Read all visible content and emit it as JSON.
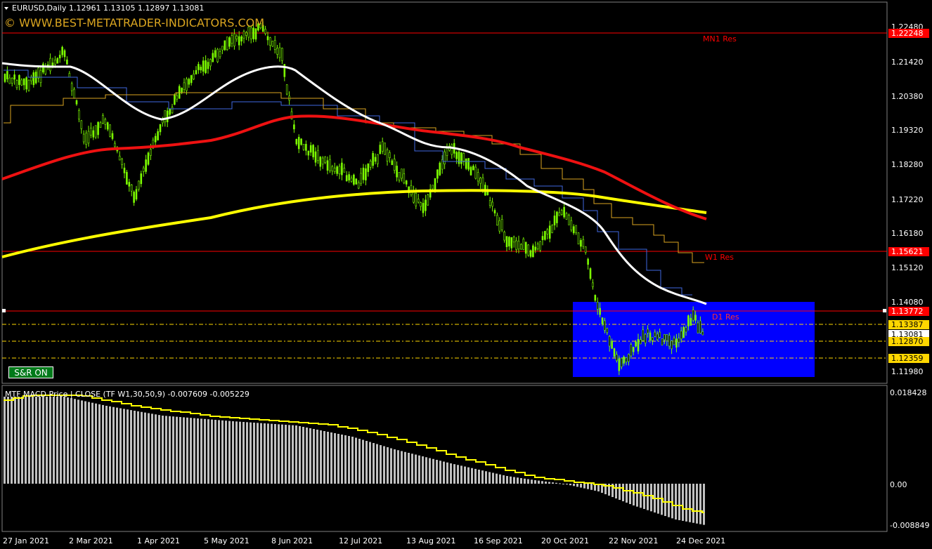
{
  "header": {
    "symbol_line": "EURUSD,Daily  1.12961 1.13105 1.12897 1.13081",
    "watermark": "© WWW.BEST-METATRADER-INDICATORS.COM"
  },
  "levels": {
    "mn1": {
      "label": "MN1 Res",
      "price": "1.22248"
    },
    "w1": {
      "label": "W1 Res",
      "price": "1.15621"
    },
    "d1": {
      "label": "D1 Res",
      "price": "1.13772"
    },
    "current": "1.13081",
    "dotted": [
      "1.13387",
      "1.12870",
      "1.12359"
    ]
  },
  "price_axis": [
    "1.22480",
    "1.21420",
    "1.20380",
    "1.19320",
    "1.18280",
    "1.17220",
    "1.16180",
    "1.15120",
    "1.14080",
    "1.11980"
  ],
  "button": {
    "label": "S&R  ON"
  },
  "macd": {
    "title": "MTF MACD Price | CLOSE  (TF W1,30,50,9) -0.007609 -0.005229",
    "axis": [
      "0.018428",
      "0.00",
      "-0.008849"
    ]
  },
  "time_axis": [
    "27 Jan 2021",
    "2 Mar 2021",
    "1 Apr 2021",
    "5 May 2021",
    "8 Jun 2021",
    "12 Jul 2021",
    "13 Aug 2021",
    "16 Sep 2021",
    "20 Oct 2021",
    "22 Nov 2021",
    "24 Dec 2021"
  ],
  "colors": {
    "background": "#000000",
    "bull_candle": "#7CFC00",
    "ma_red": "#ff0000",
    "ma_yellow": "#ffff00",
    "ma_white": "#ffffff",
    "zone": "#0000ff",
    "level_line": "#ff0000",
    "macd_hist": "#c0c0c0",
    "signal": "#ffff00"
  }
}
